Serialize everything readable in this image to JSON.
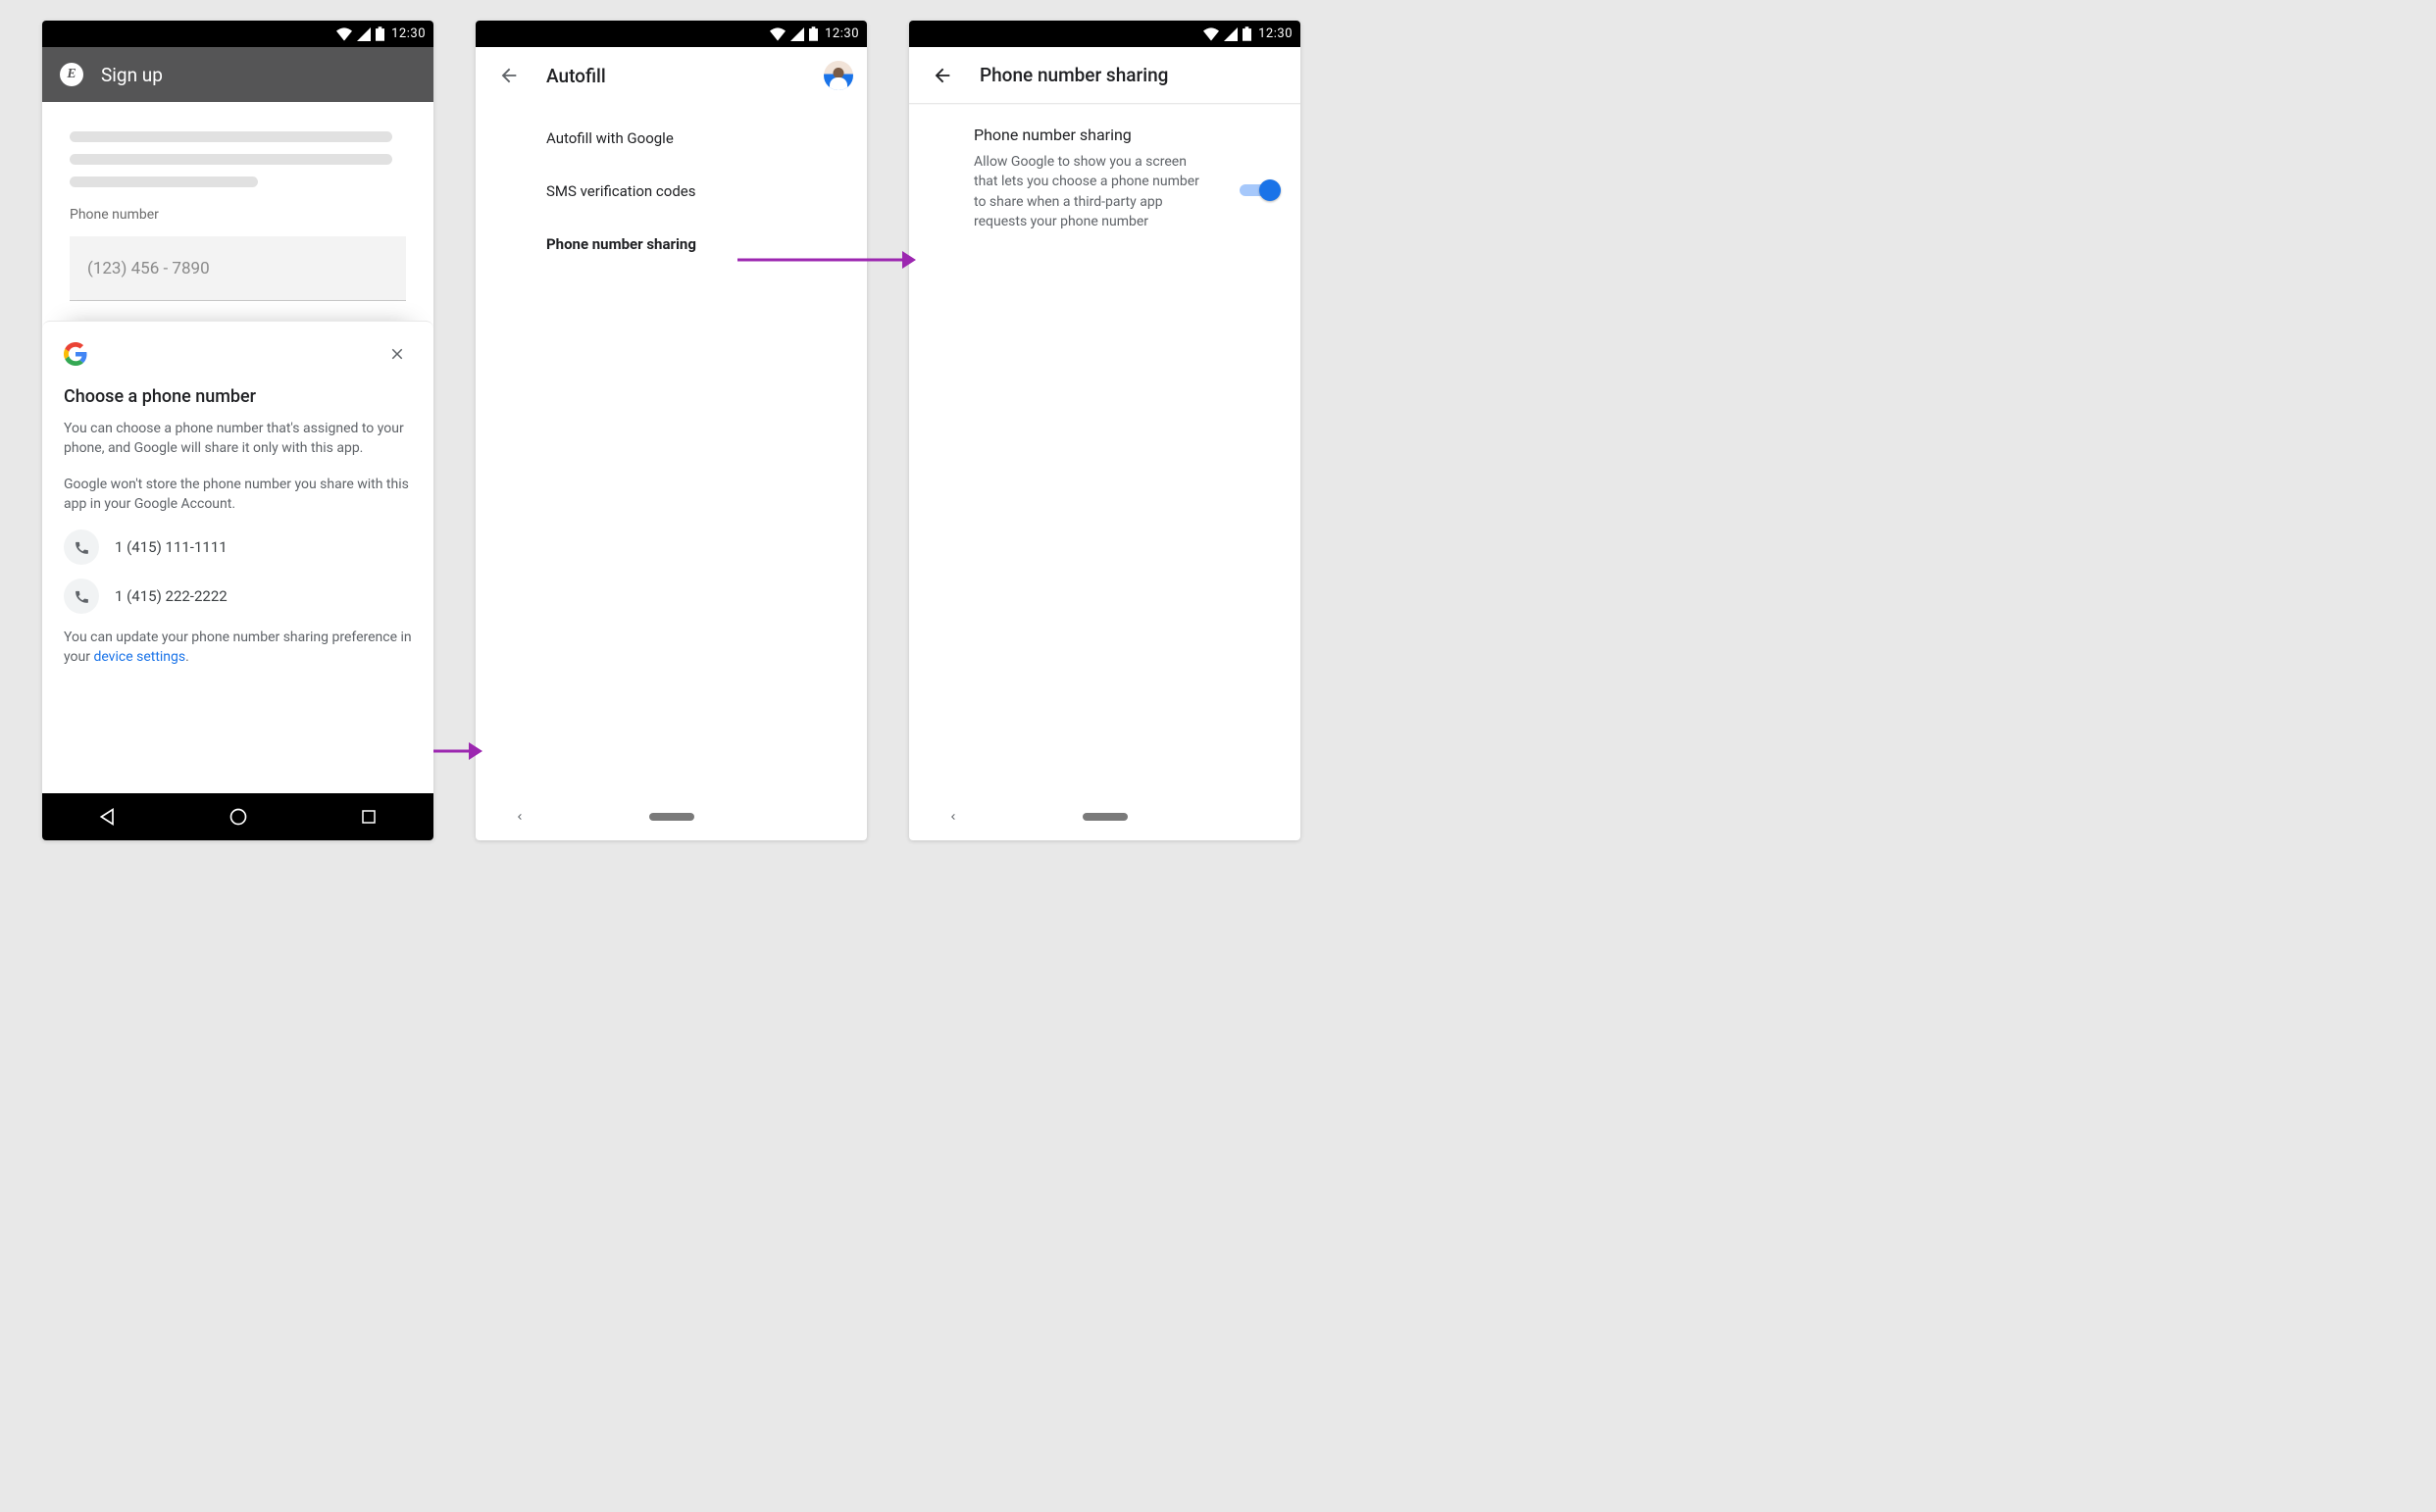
{
  "statusbar": {
    "time": "12:30"
  },
  "screen1": {
    "appbar": {
      "logo_letter": "E",
      "title": "Sign up"
    },
    "field": {
      "label": "Phone number",
      "placeholder": "(123) 456 - 7890"
    },
    "sheet": {
      "title": "Choose a phone number",
      "para1": "You can choose a phone number that's assigned to your phone, and Google will share it only with this app.",
      "para2": "Google won't store the phone number you share with this app in your Google Account.",
      "numbers": [
        "1 (415) 111-1111",
        "1 (415) 222-2222"
      ],
      "footer_pre": "You can update your phone number sharing preference in your ",
      "footer_link": "device settings",
      "footer_post": "."
    }
  },
  "screen2": {
    "appbar": {
      "title": "Autofill"
    },
    "items": [
      {
        "label": "Autofill with Google",
        "bold": false
      },
      {
        "label": "SMS verification codes",
        "bold": false
      },
      {
        "label": "Phone number sharing",
        "bold": true
      }
    ]
  },
  "screen3": {
    "appbar": {
      "title": "Phone number sharing"
    },
    "setting": {
      "title": "Phone number sharing",
      "desc": "Allow Google to show you a screen that lets you choose a phone number to share when a third-party app requests your phone number"
    }
  }
}
